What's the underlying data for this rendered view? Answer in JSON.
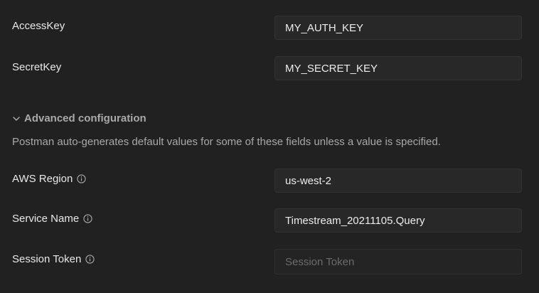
{
  "auth": {
    "access_key": {
      "label": "AccessKey",
      "value": "MY_AUTH_KEY"
    },
    "secret_key": {
      "label": "SecretKey",
      "value": "MY_SECRET_KEY"
    }
  },
  "advanced": {
    "toggle_label": "Advanced configuration",
    "expanded": true,
    "helper_text": "Postman auto-generates default values for some of these fields unless a value is specified.",
    "aws_region": {
      "label": "AWS Region",
      "value": "us-west-2",
      "icon": "info-icon"
    },
    "service_name": {
      "label": "Service Name",
      "value": "Timestream_20211105.Query",
      "icon": "info-icon"
    },
    "session_token": {
      "label": "Session Token",
      "value": "",
      "placeholder": "Session Token",
      "icon": "info-icon"
    }
  },
  "colors": {
    "background": "#212121",
    "field_background": "#282828",
    "field_border": "#333333",
    "label_text": "#e8e8e8",
    "muted_text": "#a8a8a8",
    "placeholder_text": "#6b6b6b"
  }
}
